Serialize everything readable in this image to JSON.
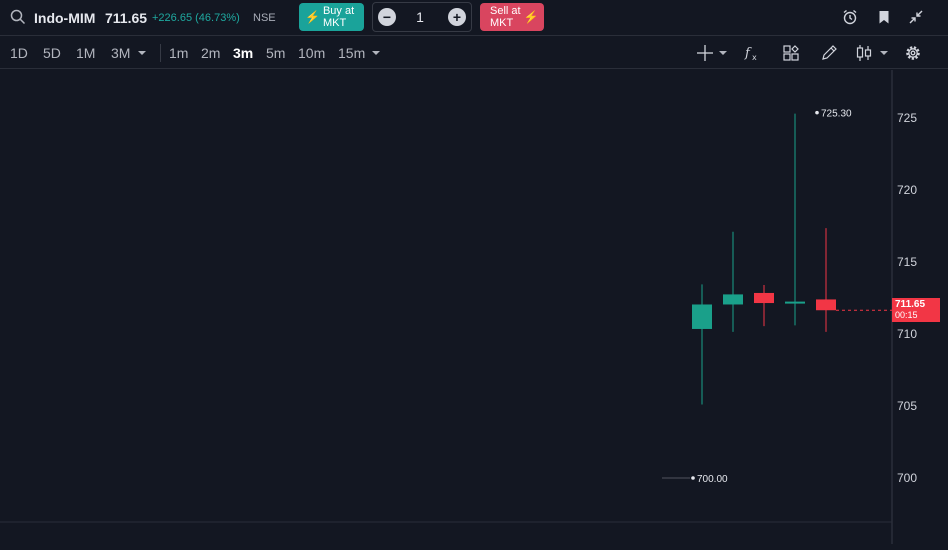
{
  "header": {
    "symbol": "Indo-MIM",
    "price": "711.65",
    "change": "+226.65 (46.73%)",
    "exchange": "NSE",
    "buy_label": "Buy at\nMKT",
    "sell_label": "Sell at\nMKT",
    "quantity": "1",
    "minus": "−",
    "plus": "+",
    "bolt": "⚡"
  },
  "icons": {
    "search": "search-icon",
    "alarm": "alarm-icon",
    "bookmark": "bookmark-icon",
    "collapse": "collapse-icon",
    "crosshair": "crosshair-icon",
    "indicators": "fx-icon",
    "templates": "layout-grid-icon",
    "draw": "pencil-icon",
    "chart_type": "candlestick-icon",
    "settings": "gear-icon"
  },
  "timeframes": {
    "ranges": [
      "1D",
      "5D",
      "1M",
      "3M"
    ],
    "intervals": [
      "1m",
      "2m",
      "3m",
      "5m",
      "10m",
      "15m"
    ],
    "active_interval": "3m"
  },
  "chart_data": {
    "type": "candlestick",
    "y_ticks": [
      "725",
      "720",
      "715",
      "710",
      "705",
      "700"
    ],
    "ylim": [
      698.6,
      727.6
    ],
    "up_color": "#1aa08a",
    "down_color": "#f23645",
    "candles": [
      {
        "open": 710.35,
        "high": 713.45,
        "low": 705.1,
        "close": 712.05
      },
      {
        "open": 712.05,
        "high": 717.1,
        "low": 710.15,
        "close": 712.75
      },
      {
        "open": 712.85,
        "high": 713.4,
        "low": 710.55,
        "close": 712.15
      },
      {
        "open": 712.15,
        "high": 725.3,
        "low": 710.6,
        "close": 712.25
      },
      {
        "open": 712.4,
        "high": 717.35,
        "low": 710.15,
        "close": 711.65
      }
    ],
    "high_annotation": "725.30",
    "low_annotation": "700.00",
    "last_price": "711.65",
    "countdown": "00:15"
  }
}
